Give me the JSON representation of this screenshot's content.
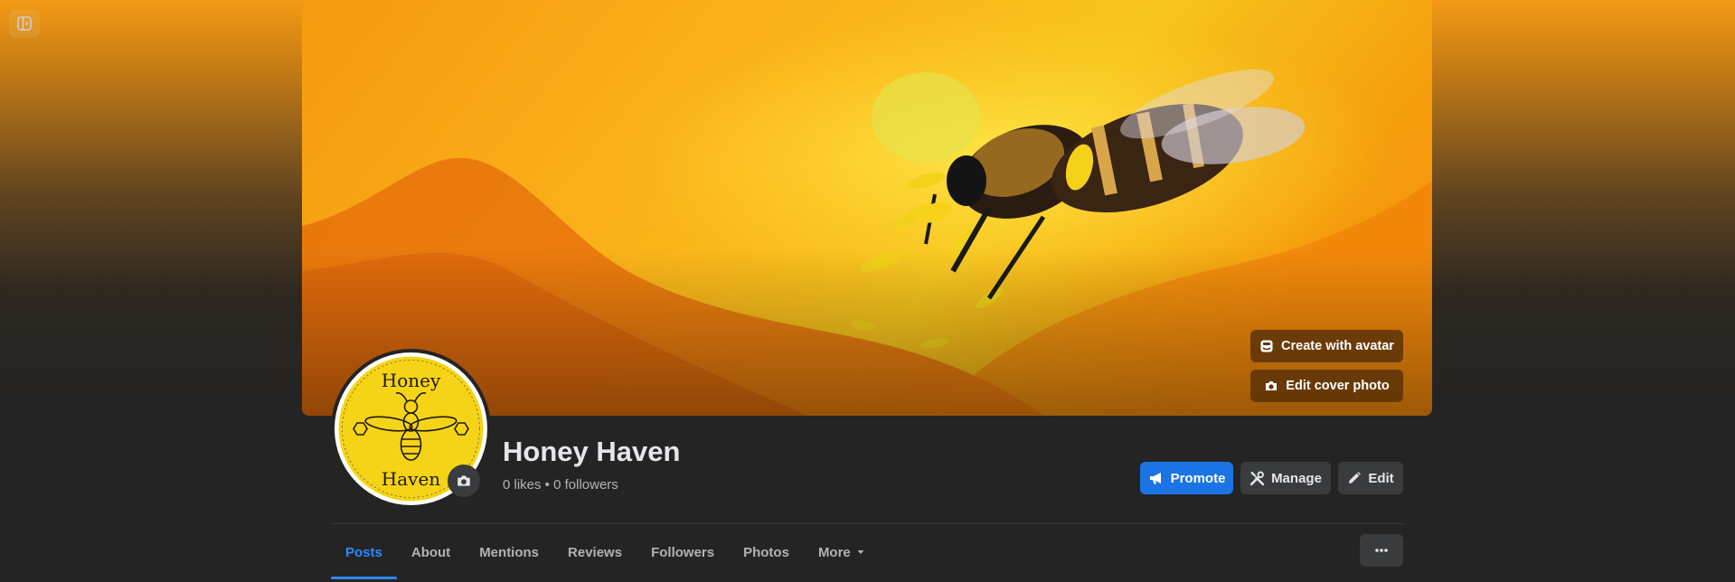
{
  "cover": {
    "create_avatar_label": "Create with avatar",
    "edit_cover_label": "Edit cover photo"
  },
  "page": {
    "name": "Honey Haven",
    "stats": "0 likes • 0 followers",
    "logo_text_top": "Honey",
    "logo_text_bottom": "Haven"
  },
  "actions": {
    "promote_label": "Promote",
    "manage_label": "Manage",
    "edit_label": "Edit"
  },
  "tabs": [
    {
      "label": "Posts",
      "active": true
    },
    {
      "label": "About"
    },
    {
      "label": "Mentions"
    },
    {
      "label": "Reviews"
    },
    {
      "label": "Followers"
    },
    {
      "label": "Photos"
    },
    {
      "label": "More"
    }
  ],
  "colors": {
    "accent": "#1b74e4",
    "active_tab": "#2d88ff",
    "logo_yellow": "#f5d418"
  },
  "icons": [
    "panel-toggle-icon",
    "avatar-sticker-icon",
    "camera-icon",
    "megaphone-icon",
    "tools-icon",
    "pencil-icon",
    "caret-down-icon",
    "ellipsis-icon"
  ]
}
